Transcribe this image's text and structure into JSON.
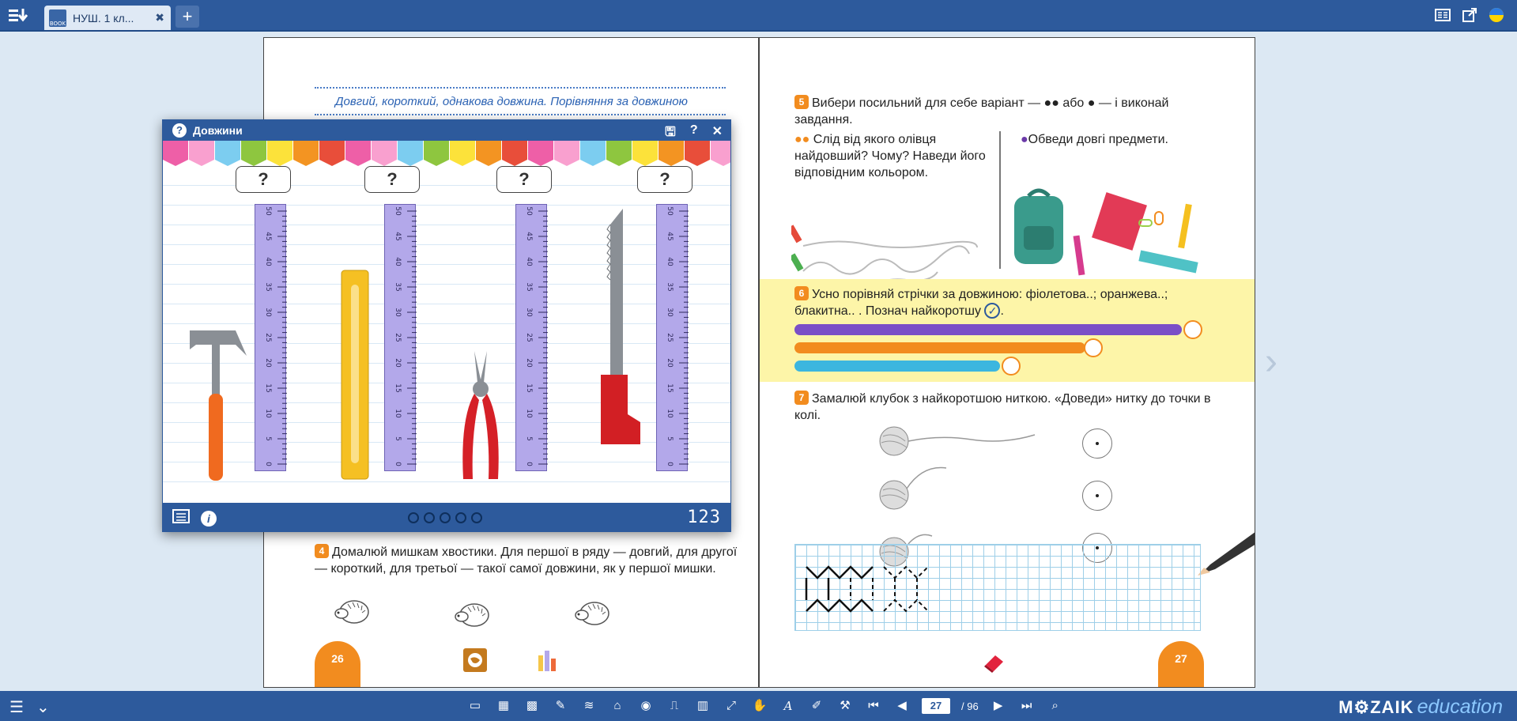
{
  "topbar": {
    "tab_title": "НУШ. 1 кл...",
    "tab_close": "✖",
    "add_tab": "+",
    "book_icon_label": "BOOK"
  },
  "left_page": {
    "topic_title": "Довгий, короткий, однакова довжина. Порівняння за довжиною",
    "task4_number": "4",
    "task4_text": "Домалюй мишкам хвостики. Для першої в ряду — довгий, для другої — короткий, для третьої — такої самої довжини, як у першої мишки.",
    "page_number": "26"
  },
  "right_page": {
    "task5_number": "5",
    "task5_text": "Вибери посильний для себе варіант — ●● або ● — і виконай завдання.",
    "task5a_text": "Слід від якого олівця найдовший? Чому? Наведи його відповідним кольором.",
    "task5b_text": "Обведи довгі предмети.",
    "task6_number": "6",
    "task6_text": "Усно порівняй стрічки за довжиною: фіолетова..; оранжева..; блакитна.. . Познач найкоротшу",
    "task7_number": "7",
    "task7_text": "Замалюй клубок з найкоротшою ниткою. «Доведи» нитку до точки в колі.",
    "page_number": "27",
    "stripes": [
      {
        "color": "#7b4fc7",
        "length": 1.0
      },
      {
        "color": "#f28c1f",
        "length": 0.75
      },
      {
        "color": "#3cb6df",
        "length": 0.53
      }
    ]
  },
  "popup": {
    "title": "Довжини",
    "question_mark": "?",
    "footer_counter": "123",
    "dots_count": 5,
    "ruler_ticks": [
      "50",
      "45",
      "40",
      "35",
      "30",
      "25",
      "20",
      "15",
      "10",
      "5",
      "0"
    ],
    "flag_colors": [
      "#ee5fa7",
      "#f9a0cf",
      "#7ccdf0",
      "#8ec63f",
      "#fce23a",
      "#f39422",
      "#e84e3a",
      "#ee5fa7",
      "#f9a0cf",
      "#7ccdf0",
      "#8ec63f",
      "#fce23a",
      "#f39422",
      "#e84e3a",
      "#ee5fa7",
      "#f9a0cf",
      "#7ccdf0",
      "#8ec63f",
      "#fce23a",
      "#f39422",
      "#e84e3a",
      "#f9a0cf"
    ]
  },
  "bottombar": {
    "current_page": "27",
    "total_pages": "/ 96",
    "brand_main": "M⚙ZAIK",
    "brand_sub": "education"
  }
}
